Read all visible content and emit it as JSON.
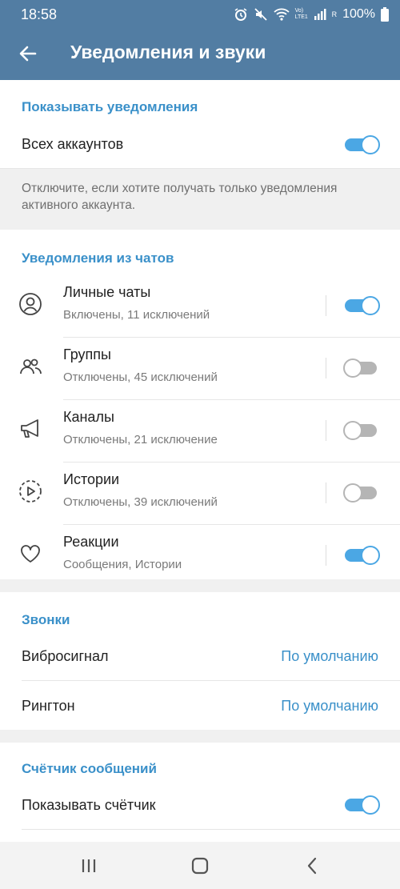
{
  "status_bar": {
    "time": "18:58",
    "lte_label": "Vo) LTE1",
    "signal_label": "R",
    "battery": "100%",
    "icons": [
      "alarm-icon",
      "mute-icon",
      "wifi-icon",
      "signal-icon",
      "battery-icon"
    ]
  },
  "app_bar": {
    "title": "Уведомления и звуки",
    "back_icon": "arrow-left-icon"
  },
  "show_notifications": {
    "header": "Показывать уведомления",
    "all_accounts": {
      "label": "Всех аккаунтов",
      "enabled": true
    },
    "info": "Отключите, если хотите получать только уведомления активного аккаунта."
  },
  "chat_notifications": {
    "header": "Уведомления из чатов",
    "items": [
      {
        "title": "Личные чаты",
        "subtitle": "Включены, 11 исключений",
        "icon": "user-icon",
        "enabled": true
      },
      {
        "title": "Группы",
        "subtitle": "Отключены, 45 исключений",
        "icon": "group-icon",
        "enabled": false
      },
      {
        "title": "Каналы",
        "subtitle": "Отключены, 21 исключение",
        "icon": "megaphone-icon",
        "enabled": false
      },
      {
        "title": "Истории",
        "subtitle": "Отключены, 39 исключений",
        "icon": "stories-icon",
        "enabled": false
      },
      {
        "title": "Реакции",
        "subtitle": "Сообщения, Истории",
        "icon": "heart-icon",
        "enabled": true
      }
    ]
  },
  "calls": {
    "header": "Звонки",
    "vibration": {
      "label": "Вибросигнал",
      "value": "По умолчанию"
    },
    "ringtone": {
      "label": "Рингтон",
      "value": "По умолчанию"
    }
  },
  "message_counter": {
    "header": "Счётчик сообщений",
    "show_counter": {
      "label": "Показывать счётчик",
      "enabled": true
    }
  },
  "nav_bar": {
    "icons": [
      "recents-icon",
      "home-icon",
      "back-icon"
    ]
  },
  "colors": {
    "header_bg": "#527da3",
    "accent": "#3a90c9",
    "toggle_on": "#4ba7e4",
    "toggle_off": "#b5b5b5",
    "section_gap": "#f0f0f0"
  }
}
